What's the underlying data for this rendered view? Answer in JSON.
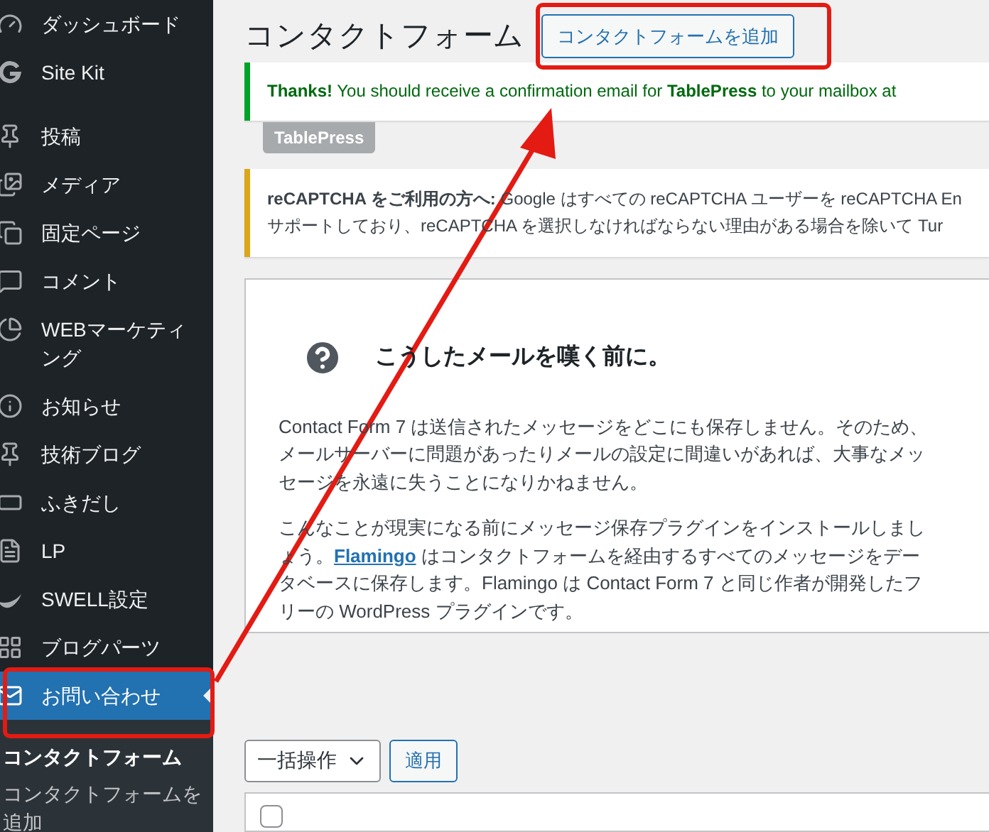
{
  "sidebar": {
    "items": [
      {
        "label": "ダッシュボード",
        "selected": false
      },
      {
        "label": "Site Kit",
        "selected": false
      },
      {
        "label": "投稿",
        "selected": false
      },
      {
        "label": "メディア",
        "selected": false
      },
      {
        "label": "固定ページ",
        "selected": false
      },
      {
        "label": "コメント",
        "selected": false
      },
      {
        "label": "WEBマーケティング",
        "selected": false
      },
      {
        "label": "お知らせ",
        "selected": false
      },
      {
        "label": "技術ブログ",
        "selected": false
      },
      {
        "label": "ふきだし",
        "selected": false
      },
      {
        "label": "LP",
        "selected": false
      },
      {
        "label": "SWELL設定",
        "selected": false
      },
      {
        "label": "ブログパーツ",
        "selected": false
      },
      {
        "label": "お問い合わせ",
        "selected": true
      }
    ],
    "submenu": [
      {
        "label": "コンタクトフォーム",
        "selected": true
      },
      {
        "label": "コンタクトフォームを追加",
        "selected": false
      }
    ]
  },
  "page": {
    "title": "コンタクトフォーム",
    "add_button": "コンタクトフォームを追加"
  },
  "notices": [
    {
      "kind": "success",
      "text": "**Thanks!** You should receive a confirmation email for **TablePress** to your mailbox at",
      "tag": "TablePress"
    },
    {
      "kind": "warning",
      "text": "**reCAPTCHA をご利用の方へ:** Google はすべての reCAPTCHA ユーザーを reCAPTCHA En",
      "text_2": "サポートしており、reCAPTCHA を選択しなければならない理由がある場合を除いて Tur"
    }
  ],
  "welcome_panel": {
    "heading": "こうしたメールを嘆く前に。",
    "paragraph_1": "Contact Form 7 は送信されたメッセージをどこにも保存しません。そのため、メールサーバーに問題があったりメールの設定に間違いがあれば、大事なメッセージを永遠に失うことになりかねません。",
    "paragraph_2": {
      "before": "こんなことが現実になる前にメッセージ保存プラグインをインストールしましょう。",
      "link": "Flamingo",
      "after": " はコンタクトフォームを経由するすべてのメッセージをデータベースに保存します。Flamingo は Contact Form 7 と同じ作者が開発したフリーの WordPress プラグインです。"
    }
  },
  "bulk_actions": {
    "select": "一括操作",
    "apply": "適用"
  },
  "table": {
    "select_all_checked": false
  }
}
